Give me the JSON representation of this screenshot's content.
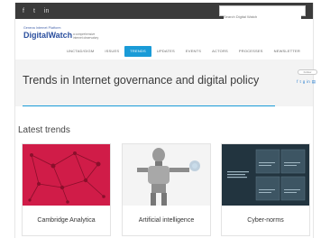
{
  "topbar": {
    "social_icons": [
      "facebook-icon",
      "twitter-icon",
      "linkedin-icon"
    ],
    "social_glyphs": [
      "f",
      "t",
      "in"
    ],
    "search_placeholder": "Search Digital Watch"
  },
  "logo": {
    "pre": "Geneva Internet Platform",
    "brand": "DigitalWatch",
    "tagline": "a comprehensive internet observatory"
  },
  "nav": {
    "items": [
      {
        "label": "UNCTAD/GIGM"
      },
      {
        "label": "ISSUES"
      },
      {
        "label": "TRENDS",
        "active": true
      },
      {
        "label": "UPDATES"
      },
      {
        "label": "EVENTS"
      },
      {
        "label": "ACTORS"
      },
      {
        "label": "PROCESSES"
      },
      {
        "label": "NEWSLETTER"
      }
    ]
  },
  "page": {
    "title": "Trends in Internet governance and digital policy",
    "follow_label": "Follow",
    "share_icons": [
      "facebook-icon",
      "twitter-icon",
      "google-plus-icon",
      "linkedin-icon",
      "print-icon"
    ]
  },
  "section": {
    "heading": "Latest trends"
  },
  "cards": [
    {
      "label": "Cambridge Analytica",
      "image": "network-graph"
    },
    {
      "label": "Artificial intelligence",
      "image": "robot"
    },
    {
      "label": "Cyber-norms",
      "image": "infographic"
    }
  ],
  "colors": {
    "accent": "#1a9bd7",
    "topbar": "#3b3b3b",
    "card1": "#d01c48",
    "card3": "#22343f"
  }
}
